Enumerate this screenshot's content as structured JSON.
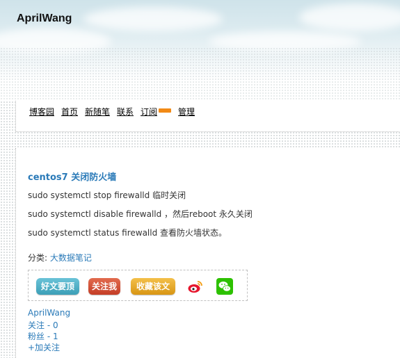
{
  "header": {
    "blog_title": "AprilWang"
  },
  "nav": {
    "items": [
      "博客园",
      "首页",
      "新随笔",
      "联系",
      "订阅",
      "管理"
    ]
  },
  "post": {
    "title": "centos7 关闭防火墙",
    "paragraphs": [
      "sudo systemctl stop firewalld 临时关闭",
      "sudo systemctl disable firewalld ，然后reboot 永久关闭",
      "sudo systemctl status  firewalld 查看防火墙状态。"
    ],
    "category_label": "分类:",
    "category_value": "大数据笔记"
  },
  "share": {
    "good_post": "好文要顶",
    "follow": "关注我",
    "favorite": "收藏该文"
  },
  "author": {
    "name": "AprilWang",
    "following": "关注 - 0",
    "followers": "粉丝 - 1",
    "add_follow": "+加关注"
  },
  "colors": {
    "link": "#2a7ab8",
    "rss": "#f28a16"
  }
}
